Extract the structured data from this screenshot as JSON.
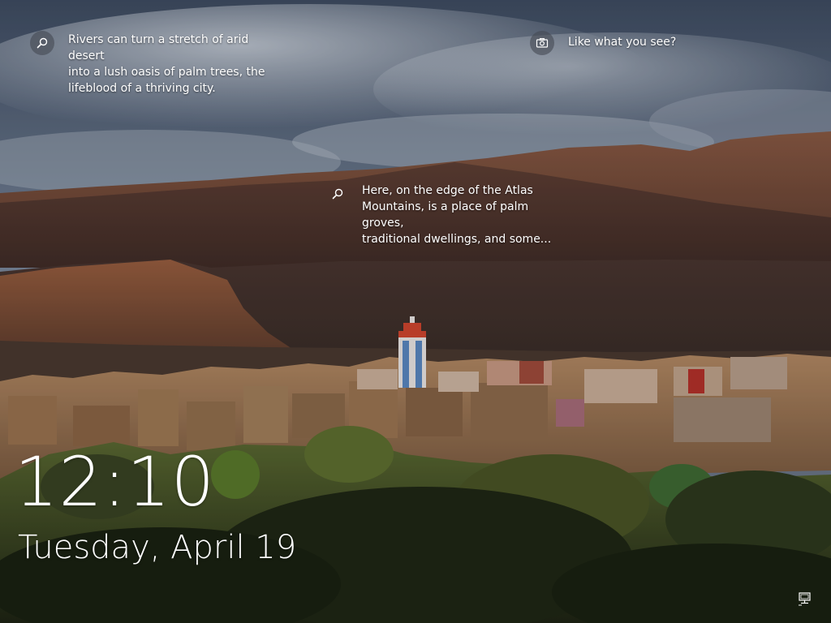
{
  "lockscreen": {
    "tips": [
      {
        "icon": "search-icon",
        "text": "Rivers can turn a stretch of arid desert\ninto a lush oasis of palm trees, the\nlifeblood of a thriving city."
      },
      {
        "icon": "camera-icon",
        "text": "Like what you see?"
      },
      {
        "icon": "search-icon",
        "text": "Here, on the edge of the Atlas\nMountains, is a place of palm groves,\ntraditional dwellings, and some..."
      }
    ],
    "time": "12:10",
    "date": "Tuesday, April 19",
    "status_icons": [
      "network-icon"
    ]
  },
  "colors": {
    "sky": "#6f7f97",
    "mountain": "#7a4a35",
    "cliff": "#8c5a3e",
    "village": "#a87b55",
    "palms": "#2f3a1f",
    "text": "#ffffff"
  }
}
